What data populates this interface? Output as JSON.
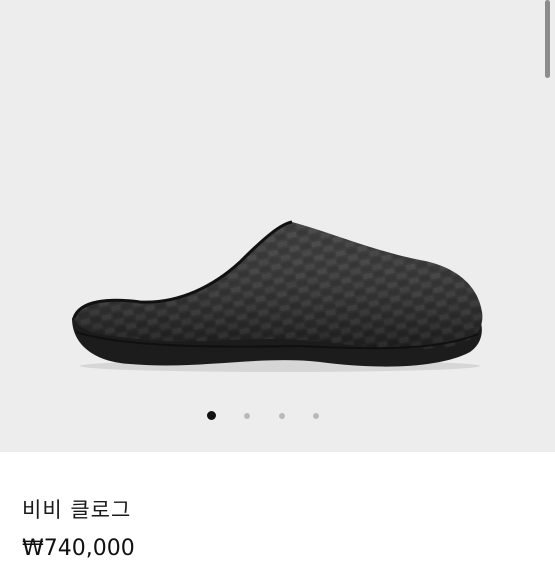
{
  "product": {
    "name": "비비 클로그",
    "price": "₩740,000",
    "image_icon": "woven-clog-image"
  },
  "gallery": {
    "total_images": 4,
    "active_index": 0
  },
  "colors": {
    "gallery_background": "#ededed",
    "active_dot": "#111111",
    "inactive_dot": "#b9b9b9"
  }
}
